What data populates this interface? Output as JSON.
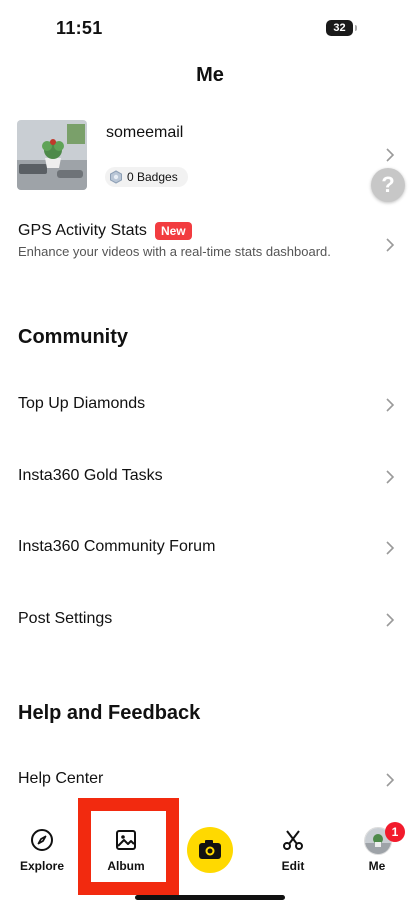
{
  "status_bar": {
    "time": "11:51",
    "battery_level": "32"
  },
  "header": {
    "title": "Me"
  },
  "profile": {
    "username": "someemail",
    "badges_label": "0 Badges"
  },
  "help_button": {
    "glyph": "?"
  },
  "gps": {
    "title": "GPS Activity Stats",
    "badge": "New",
    "subtitle": "Enhance your videos with a real-time stats dashboard."
  },
  "community": {
    "title": "Community",
    "items": [
      {
        "label": "Top Up Diamonds"
      },
      {
        "label": "Insta360 Gold Tasks"
      },
      {
        "label": "Insta360 Community Forum"
      },
      {
        "label": "Post Settings"
      }
    ]
  },
  "help_feedback": {
    "title": "Help and Feedback",
    "items": [
      {
        "label": "Help Center"
      }
    ]
  },
  "tabbar": {
    "explore": "Explore",
    "album": "Album",
    "edit": "Edit",
    "me": "Me",
    "me_notification_count": "1"
  },
  "colors": {
    "accent_yellow": "#ffd900",
    "new_badge": "#f23c40",
    "highlight": "#f22a0f"
  }
}
